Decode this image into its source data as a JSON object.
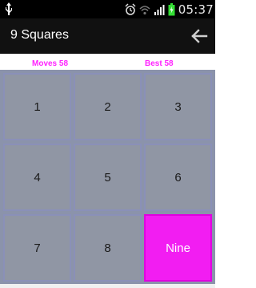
{
  "status_bar": {
    "time": "05:37",
    "icons": [
      "usb-icon",
      "alarm-icon",
      "wifi-icon",
      "signal-icon",
      "battery-icon"
    ]
  },
  "action_bar": {
    "title": "9 Squares",
    "back_icon": "arrow-left-icon"
  },
  "score": {
    "moves_label": "Moves 58",
    "best_label": "Best 58"
  },
  "colors": {
    "accent": "#ff22ff",
    "tile": "#9096a4",
    "special_tile": "#f21df2"
  },
  "tiles": [
    {
      "label": "1"
    },
    {
      "label": "2"
    },
    {
      "label": "3"
    },
    {
      "label": "4"
    },
    {
      "label": "5"
    },
    {
      "label": "6"
    },
    {
      "label": "7"
    },
    {
      "label": "8"
    },
    {
      "label": "Nine"
    }
  ]
}
